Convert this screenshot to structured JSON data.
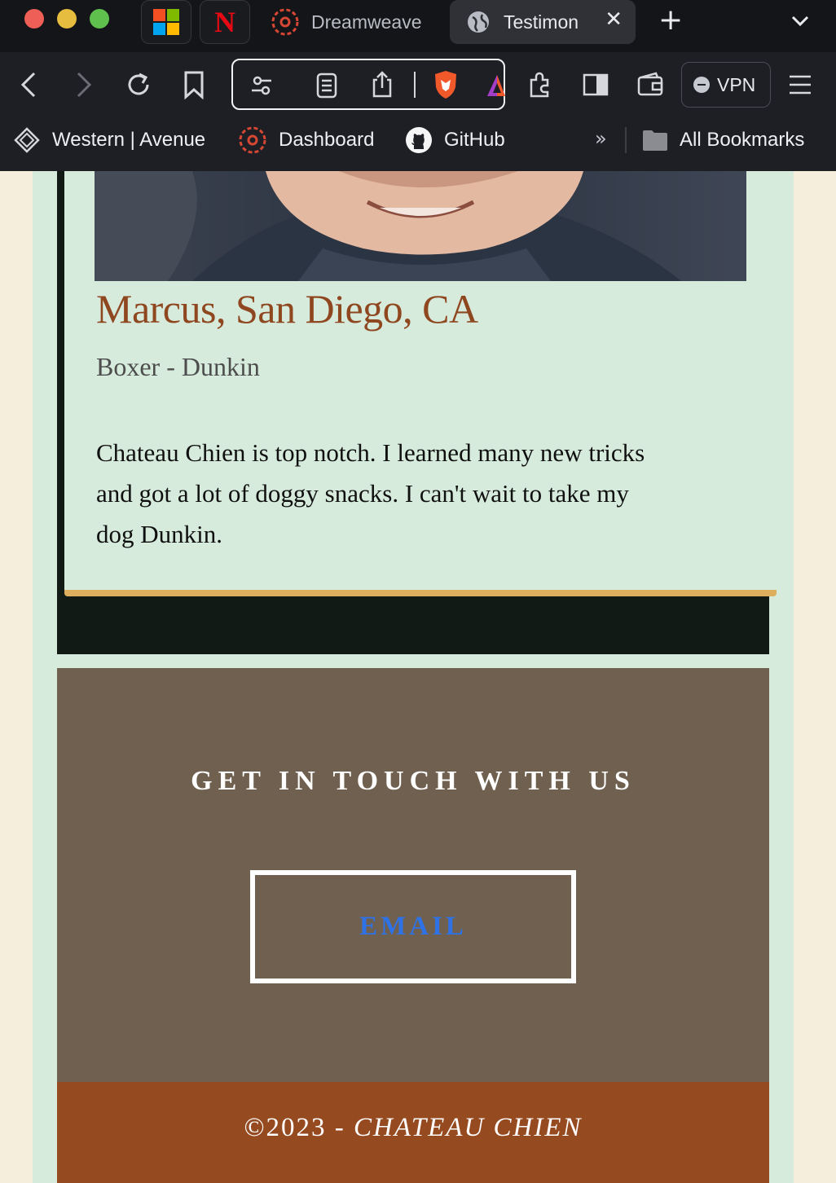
{
  "browser": {
    "tabs": [
      {
        "title": "Dreamweave"
      },
      {
        "title": "Testimon",
        "active": true
      }
    ],
    "vpn_label": "VPN",
    "bookmarks": [
      {
        "label": "Western | Avenue"
      },
      {
        "label": "Dashboard"
      },
      {
        "label": "GitHub"
      }
    ],
    "overflow_label": "»",
    "all_bookmarks_label": "All Bookmarks"
  },
  "testimonial": {
    "name": "Marcus, San Diego, CA",
    "pet": "Boxer - Dunkin",
    "quote": "Chateau Chien is top notch. I learned many new tricks and got a lot of doggy snacks. I can't wait to take my dog Dunkin."
  },
  "contact": {
    "heading": "GET IN TOUCH WITH US",
    "email_button": "EMAIL"
  },
  "footer": {
    "copyright": "©2023 - ",
    "brand": "CHATEAU CHIEN"
  },
  "colors": {
    "page_bg": "#d6ebdc",
    "name_text": "#8f4720",
    "card_accent": "#dcae5e",
    "contact_bg": "#70604f",
    "email_link": "#2f72e6",
    "footer_bg": "#964a20"
  }
}
